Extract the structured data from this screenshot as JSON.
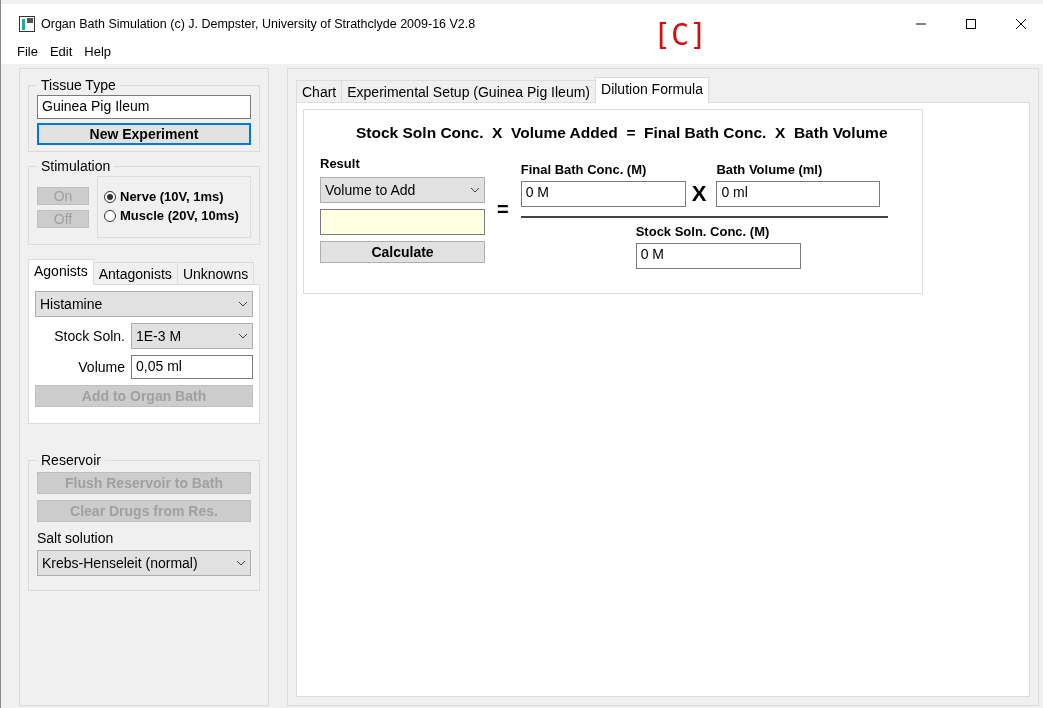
{
  "window": {
    "title": "Organ Bath Simulation (c) J. Dempster, University of Strathclyde 2009-16 V2.8"
  },
  "figure_label": "[C]",
  "menu": [
    "File",
    "Edit",
    "Help"
  ],
  "tissue": {
    "legend": "Tissue Type",
    "value": "Guinea Pig Ileum",
    "button": "New Experiment"
  },
  "stimulation": {
    "legend": "Stimulation",
    "buttons": [
      {
        "label": "On",
        "disabled": true
      },
      {
        "label": "Off",
        "disabled": true
      }
    ],
    "modes": [
      {
        "label": "Nerve (10V, 1ms)",
        "selected": true
      },
      {
        "label": "Muscle (20V, 10ms)",
        "selected": false
      }
    ]
  },
  "drug_tabs": [
    {
      "label": "Agonists",
      "selected": true
    },
    {
      "label": "Antagonists",
      "selected": false
    },
    {
      "label": "Unknowns",
      "selected": false
    }
  ],
  "drug": {
    "select": "Histamine",
    "stock_label": "Stock Soln.",
    "stock_value": "1E-3 M",
    "volume_label": "Volume",
    "volume_value": "0,05 ml",
    "add_button": {
      "label": "Add to Organ Bath",
      "disabled": true
    }
  },
  "reservoir": {
    "legend": "Reservoir",
    "buttons": [
      {
        "label": "Flush Reservoir to Bath",
        "disabled": true
      },
      {
        "label": "Clear Drugs from Res.",
        "disabled": true
      }
    ],
    "salt_label": "Salt solution",
    "salt_value": "Krebs-Henseleit (normal)"
  },
  "main_tabs": [
    {
      "label": "Chart",
      "selected": false
    },
    {
      "label": "Experimental Setup (Guinea Pig Ileum)",
      "selected": false
    },
    {
      "label": "Dilution Formula",
      "selected": true
    }
  ],
  "formula": {
    "equation": "Stock Soln Conc.  X  Volume Added  =  Final Bath Conc.  X  Bath Volume",
    "result_label": "Result",
    "result_select": "Volume to Add",
    "calculate": "Calculate",
    "equals": "=",
    "times": "X",
    "final_label": "Final Bath Conc. (M)",
    "final_value": "0 M",
    "bath_label": "Bath Volume (ml)",
    "bath_value": "0 ml",
    "stock_label": "Stock Soln. Conc. (M)",
    "stock_value": "0 M"
  }
}
